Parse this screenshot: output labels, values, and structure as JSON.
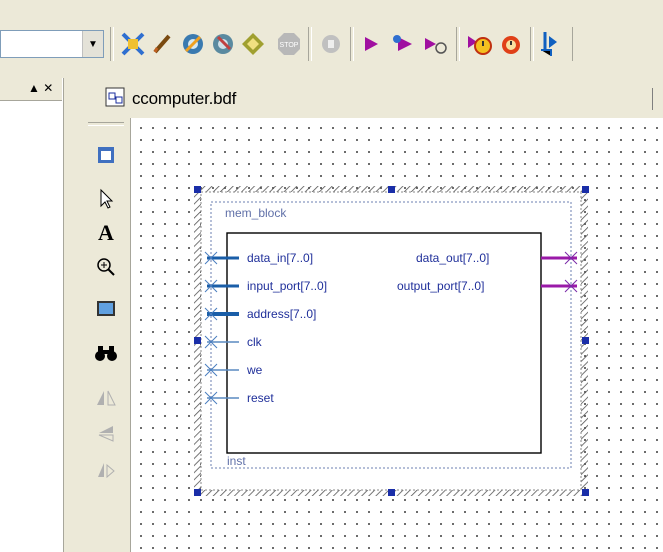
{
  "toolbar": {
    "combo_value": "",
    "buttons": [
      {
        "name": "compile-cancel-icon",
        "glyph": "✕",
        "color": "#2060c0"
      },
      {
        "name": "pencil-icon",
        "glyph": "✎",
        "color": "#604020"
      },
      {
        "name": "analysis-synthesis-icon",
        "glyph": "◍",
        "color": "#206090"
      },
      {
        "name": "fitter-icon",
        "glyph": "◍",
        "color": "#406080"
      },
      {
        "name": "assembler-icon",
        "glyph": "◈",
        "color": "#808020"
      },
      {
        "name": "stop-icon",
        "glyph": "STOP",
        "color": "#9a9a9a"
      },
      {
        "name": "timing-analyzer-icon",
        "glyph": "◉",
        "color": "#9a9a9a"
      },
      {
        "name": "start-compilation-icon",
        "glyph": "▶",
        "color": "#a01090"
      },
      {
        "name": "start-analysis-icon",
        "glyph": "▶",
        "color": "#a01090"
      },
      {
        "name": "start-timing-icon",
        "glyph": "▶",
        "color": "#a01090"
      },
      {
        "name": "simulator-icon",
        "glyph": "⏱",
        "color": "#c03010"
      },
      {
        "name": "simulator-stop-icon",
        "glyph": "⏱",
        "color": "#c03010"
      },
      {
        "name": "programmer-icon",
        "glyph": "⇣",
        "color": "#1060c0"
      }
    ]
  },
  "left_pane": {
    "controls": "▲ ✕"
  },
  "document": {
    "title": "ccomputer.bdf"
  },
  "block": {
    "name": "mem_block",
    "instance": "inst",
    "inputs": [
      "data_in[7..0]",
      "input_port[7..0]",
      "address[7..0]",
      "clk",
      "we",
      "reset"
    ],
    "outputs": [
      "data_out[7..0]",
      "output_port[7..0]"
    ]
  },
  "colors": {
    "accent": "#1a2e9c",
    "output_wire": "#9a1aa8",
    "selection": "#1a2ea8"
  }
}
